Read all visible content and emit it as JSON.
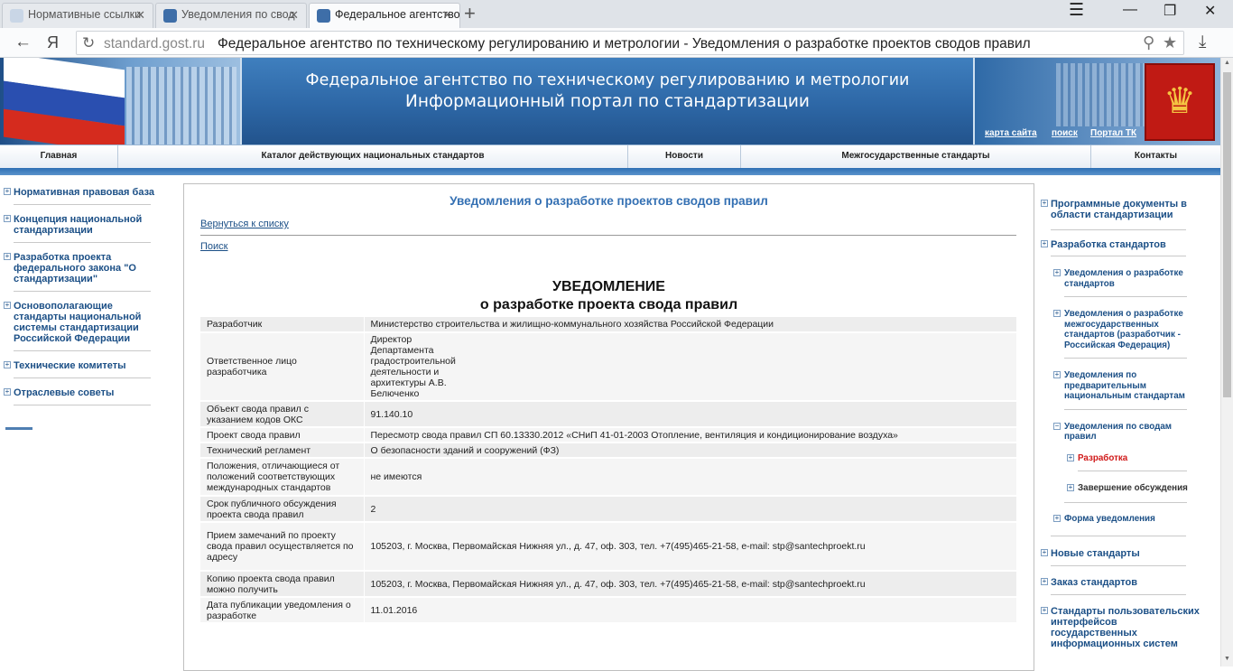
{
  "browser": {
    "tabs": [
      {
        "title": "Нормативные ссылки"
      },
      {
        "title": "Уведомления по свод"
      },
      {
        "title": "Федеральное агентство"
      }
    ],
    "new_tab": "+",
    "yandex": "Я",
    "address": {
      "domain": "standard.gost.ru",
      "title": "Федеральное агентство по техническому регулированию и метрологии - Уведомления о разработке проектов сводов правил"
    }
  },
  "header": {
    "title_line1": "Федеральное агентство по техническому регулированию и метрологии",
    "title_line2": "Информационный портал по стандартизации",
    "links": [
      "карта сайта",
      "поиск",
      "Портал ТК"
    ]
  },
  "mainnav": [
    "Главная",
    "Каталог действующих национальных стандартов",
    "Новости",
    "Межгосударственные стандарты",
    "Контакты"
  ],
  "leftnav": [
    "Нормативная правовая база",
    "Концепция национальной стандартизации",
    "Разработка проекта федерального закона \"О стандартизации\"",
    "Основополагающие стандарты национальной системы стандартизации Российской Федерации",
    "Технические комитеты",
    "Отраслевые советы"
  ],
  "content": {
    "title": "Уведомления о разработке проектов сводов правил",
    "back_link": "Вернуться к списку",
    "search_link": "Поиск",
    "heading1": "УВЕДОМЛЕНИЕ",
    "heading2": "о разработке проекта свода правил",
    "rows": [
      {
        "label": "Разработчик",
        "value": "Министерство строительства и жилищно-коммунального хозяйства Российской Федерации"
      },
      {
        "label": "Ответственное лицо разработчика",
        "value": "Директор Департамента градостроительной деятельности и архитектуры А.В. Белюченко"
      },
      {
        "label": "Объект свода правил с указанием кодов ОКС",
        "value": "91.140.10"
      },
      {
        "label": "Проект свода правил",
        "value": "Пересмотр свода правил СП 60.13330.2012 «СНиП 41-01-2003 Отопление, вентиляция и кондиционирование воздуха»"
      },
      {
        "label": "Технический регламент",
        "value": "О безопасности зданий и сооружений (ФЗ)"
      },
      {
        "label": "Положения, отличающиеся от положений соответствующих международных стандартов",
        "value": "не имеются"
      },
      {
        "label": "Срок публичного обсуждения проекта свода правил",
        "value": "2"
      },
      {
        "label": "Прием замечаний по проекту свода правил осуществляется по адресу",
        "value": "105203, г. Москва, Первомайская Нижняя ул., д. 47, оф. 303, тел. +7(495)465-21-58, e-mail: stp@santechproekt.ru"
      },
      {
        "label": "Копию проекта свода правил можно получить",
        "value": "105203, г. Москва, Первомайская Нижняя ул., д. 47, оф. 303, тел. +7(495)465-21-58, e-mail: stp@santechproekt.ru"
      },
      {
        "label": "Дата публикации уведомления о разработке",
        "value": "11.01.2016"
      }
    ]
  },
  "rightnav": {
    "item1": "Программные документы в области стандартизации",
    "item2": "Разработка стандартов",
    "sub1": "Уведомления о разработке стандартов",
    "sub2": "Уведомления о разработке межгосударственных стандартов (разработчик - Российская Федерация)",
    "sub3": "Уведомления по предварительным национальным стандартам",
    "sub4": "Уведомления по сводам правил",
    "sub4a": "Разработка",
    "sub4b": "Завершение обсуждения",
    "sub5": "Форма уведомления",
    "item3": "Новые стандарты",
    "item4": "Заказ стандартов",
    "item5": "Стандарты пользовательских интерфейсов государственных информационных систем"
  },
  "colors": {
    "header_blue": "#2d67a6",
    "link_blue": "#1b4f86",
    "title_blue": "#3470b3",
    "active_red": "#d01818"
  }
}
